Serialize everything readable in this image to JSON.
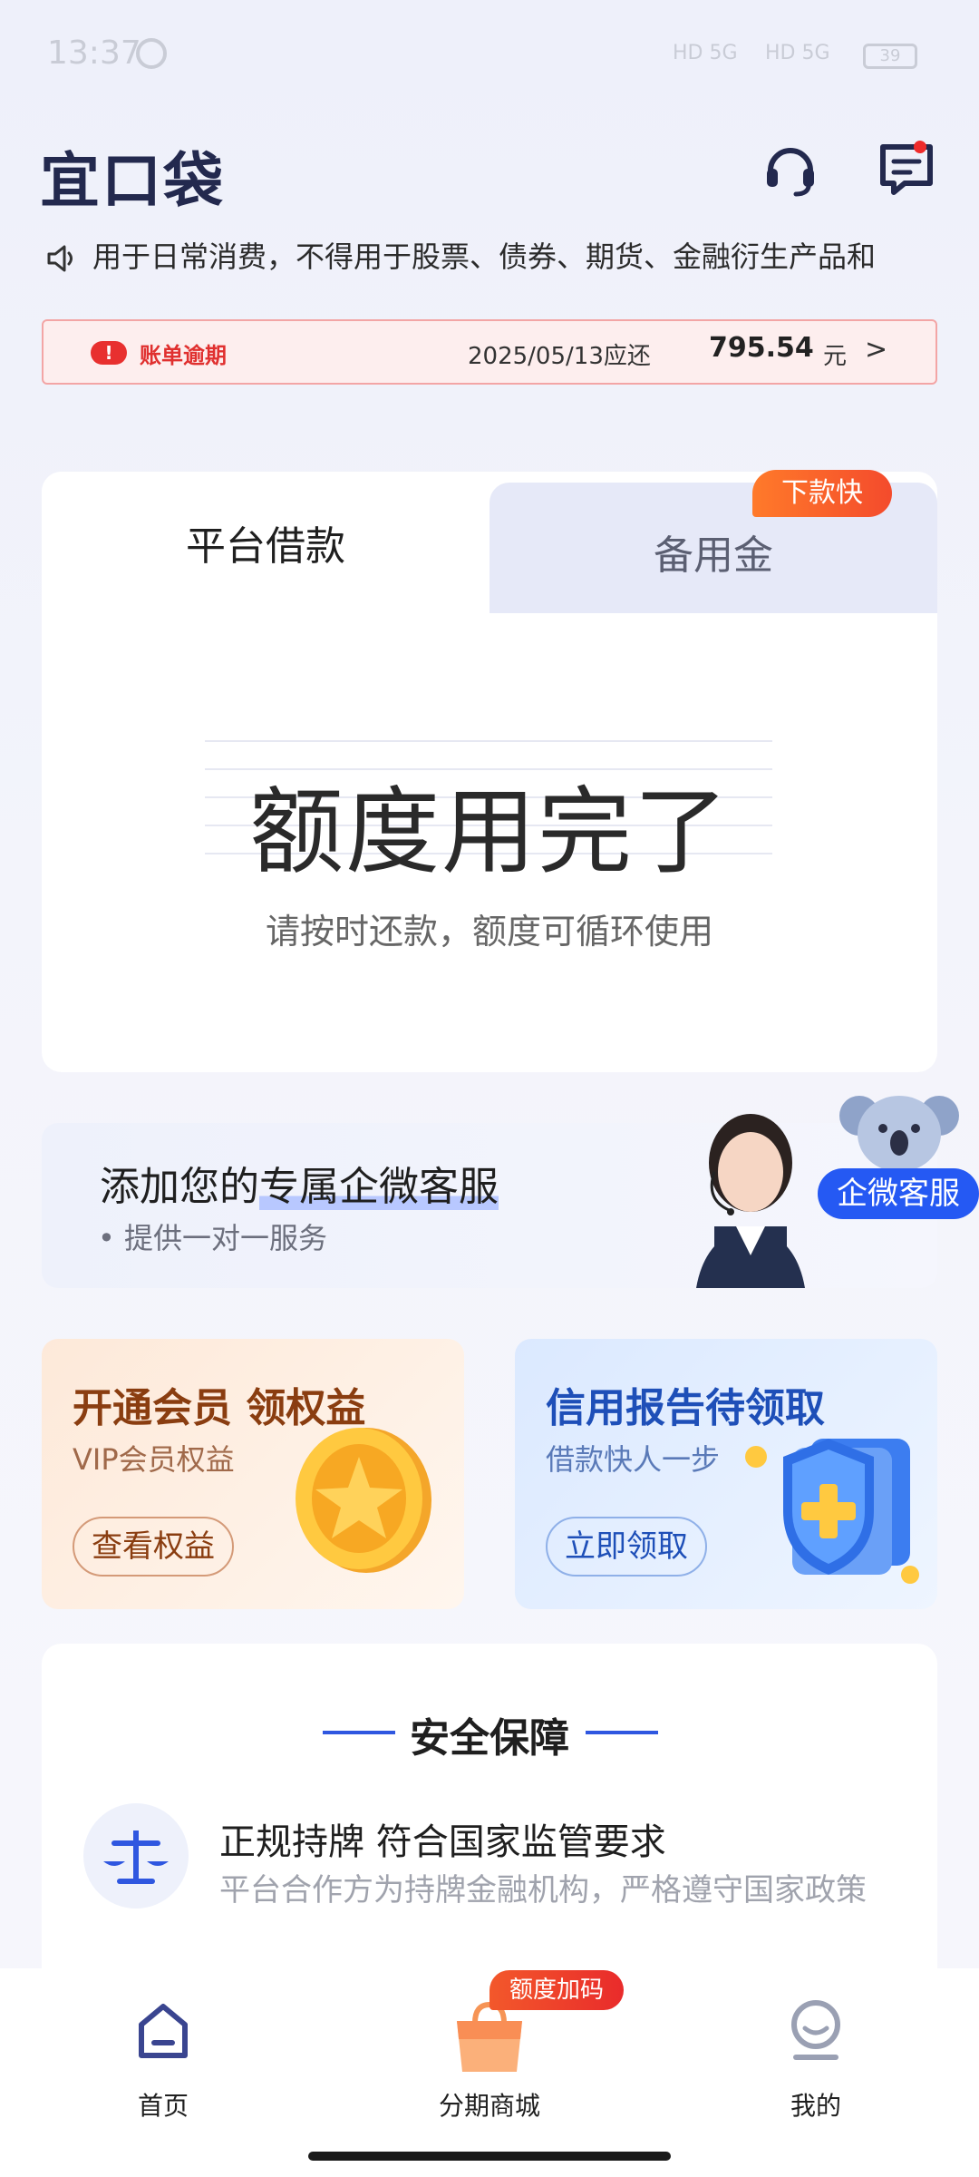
{
  "status": {
    "time": "13:37",
    "signal1": "HD 5G",
    "signal2": "HD 5G",
    "battery": "39"
  },
  "header": {
    "logo": "宜口袋",
    "support_icon": "headset-icon",
    "message_icon": "message-icon"
  },
  "notice": {
    "text": "用于日常消费，不得用于股票、债券、期货、金融衍生产品和"
  },
  "bill": {
    "label": "账单逾期",
    "due_text": "2025/05/13应还",
    "amount": "795.54",
    "unit": "元",
    "chevron": ">"
  },
  "tabs": {
    "platform": "平台借款",
    "reserve": "备用金",
    "badge": "下款快"
  },
  "quota": {
    "title": "额度用完了",
    "subtitle": "请按时还款，额度可循环使用"
  },
  "cs_banner": {
    "title_prefix": "添加您的",
    "title_highlight": "专属企微客服",
    "subtitle": "• 提供一对一服务",
    "pill": "企微客服"
  },
  "promo_member": {
    "title": "开通会员 领权益",
    "subtitle": "VIP会员权益",
    "button": "查看权益"
  },
  "promo_credit": {
    "title": "信用报告待领取",
    "subtitle": "借款快人一步",
    "button": "立即领取"
  },
  "safety": {
    "title": "安全保障",
    "item_title": "正规持牌 符合国家监管要求",
    "item_desc": "平台合作方为持牌金融机构，严格遵守国家政策"
  },
  "tabbar": {
    "home": "首页",
    "mall": "分期商城",
    "mine": "我的",
    "mall_badge": "额度加码"
  },
  "colors": {
    "brand": "#23294e",
    "accent_blue": "#2559f3",
    "alert_red": "#e0302f",
    "orange": "#f46a2b"
  }
}
